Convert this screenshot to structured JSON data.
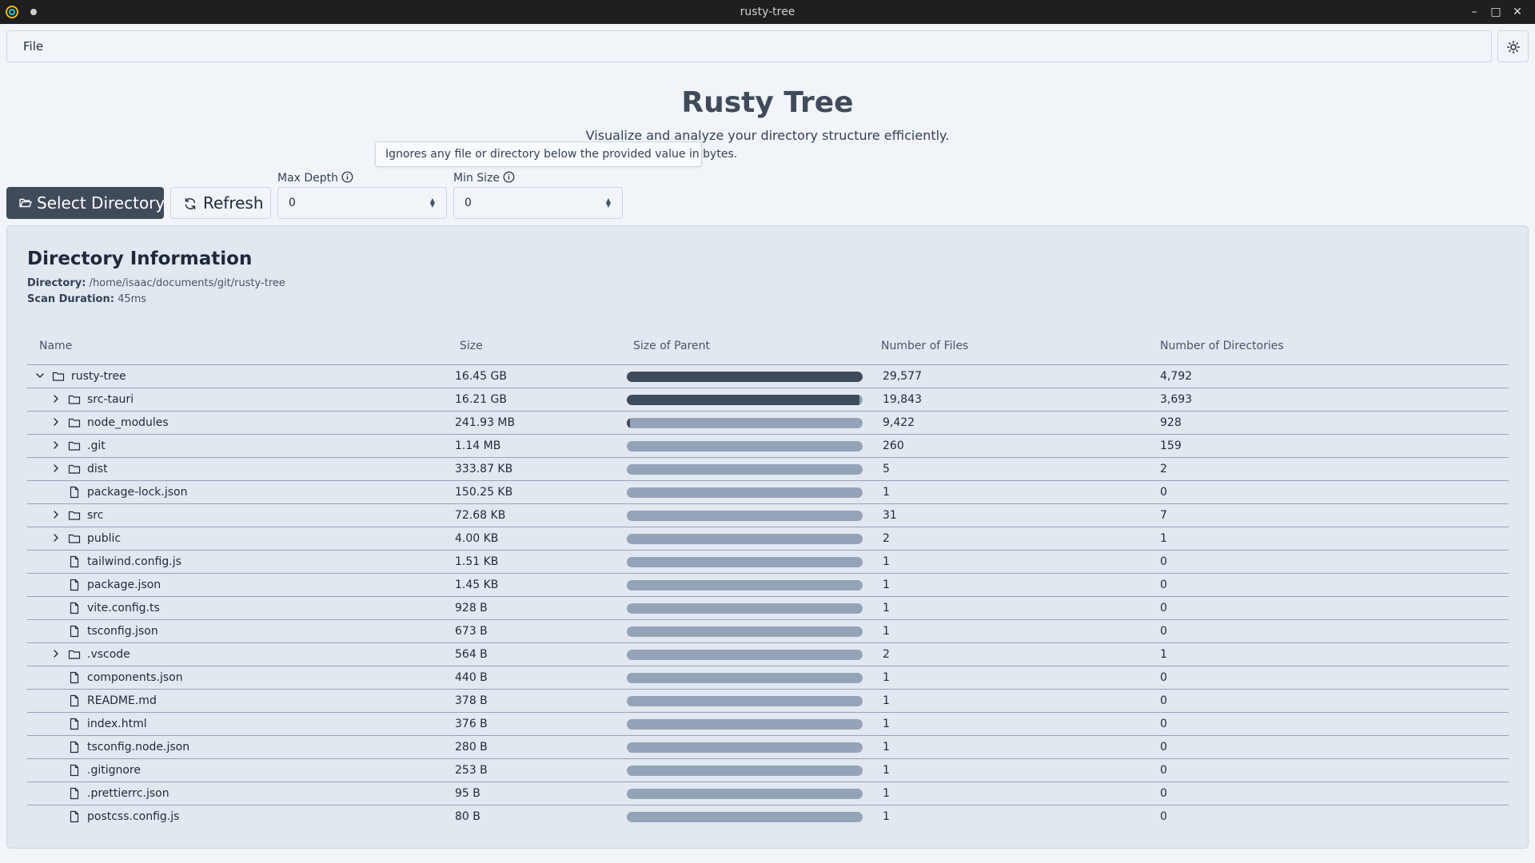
{
  "window": {
    "title": "rusty-tree"
  },
  "menu": {
    "file_label": "File"
  },
  "hero": {
    "title": "Rusty Tree",
    "subtitle": "Visualize and analyze your directory structure efficiently."
  },
  "tooltip": {
    "text": "Ignores any file or directory below the provided value in bytes."
  },
  "controls": {
    "select_directory_label": "Select Directory",
    "refresh_label": "Refresh",
    "max_depth_label": "Max Depth",
    "max_depth_value": "0",
    "min_size_label": "Min Size",
    "min_size_value": "0"
  },
  "panel": {
    "title": "Directory Information",
    "directory_label": "Directory:",
    "directory_value": "/home/isaac/documents/git/rusty-tree",
    "duration_label": "Scan Duration:",
    "duration_value": "45ms"
  },
  "table": {
    "headers": {
      "name": "Name",
      "size": "Size",
      "size_of_parent": "Size of Parent",
      "files": "Number of Files",
      "dirs": "Number of Directories"
    },
    "rows": [
      {
        "name": "rusty-tree",
        "kind": "dir",
        "expanded": true,
        "level": 0,
        "size": "16.45 GB",
        "fraction": 1.0,
        "files": "29,577",
        "dirs": "4,792"
      },
      {
        "name": "src-tauri",
        "kind": "dir",
        "expanded": false,
        "level": 1,
        "size": "16.21 GB",
        "fraction": 0.985,
        "files": "19,843",
        "dirs": "3,693"
      },
      {
        "name": "node_modules",
        "kind": "dir",
        "expanded": false,
        "level": 1,
        "size": "241.93 MB",
        "fraction": 0.015,
        "files": "9,422",
        "dirs": "928"
      },
      {
        "name": ".git",
        "kind": "dir",
        "expanded": false,
        "level": 1,
        "size": "1.14 MB",
        "fraction": 0.0,
        "files": "260",
        "dirs": "159"
      },
      {
        "name": "dist",
        "kind": "dir",
        "expanded": false,
        "level": 1,
        "size": "333.87 KB",
        "fraction": 0.0,
        "files": "5",
        "dirs": "2"
      },
      {
        "name": "package-lock.json",
        "kind": "file",
        "level": 1,
        "size": "150.25 KB",
        "fraction": 0.0,
        "files": "1",
        "dirs": "0"
      },
      {
        "name": "src",
        "kind": "dir",
        "expanded": false,
        "level": 1,
        "size": "72.68 KB",
        "fraction": 0.0,
        "files": "31",
        "dirs": "7"
      },
      {
        "name": "public",
        "kind": "dir",
        "expanded": false,
        "level": 1,
        "size": "4.00 KB",
        "fraction": 0.0,
        "files": "2",
        "dirs": "1"
      },
      {
        "name": "tailwind.config.js",
        "kind": "file",
        "level": 1,
        "size": "1.51 KB",
        "fraction": 0.0,
        "files": "1",
        "dirs": "0"
      },
      {
        "name": "package.json",
        "kind": "file",
        "level": 1,
        "size": "1.45 KB",
        "fraction": 0.0,
        "files": "1",
        "dirs": "0"
      },
      {
        "name": "vite.config.ts",
        "kind": "file",
        "level": 1,
        "size": "928 B",
        "fraction": 0.0,
        "files": "1",
        "dirs": "0"
      },
      {
        "name": "tsconfig.json",
        "kind": "file",
        "level": 1,
        "size": "673 B",
        "fraction": 0.0,
        "files": "1",
        "dirs": "0"
      },
      {
        "name": ".vscode",
        "kind": "dir",
        "expanded": false,
        "level": 1,
        "size": "564 B",
        "fraction": 0.0,
        "files": "2",
        "dirs": "1"
      },
      {
        "name": "components.json",
        "kind": "file",
        "level": 1,
        "size": "440 B",
        "fraction": 0.0,
        "files": "1",
        "dirs": "0"
      },
      {
        "name": "README.md",
        "kind": "file",
        "level": 1,
        "size": "378 B",
        "fraction": 0.0,
        "files": "1",
        "dirs": "0"
      },
      {
        "name": "index.html",
        "kind": "file",
        "level": 1,
        "size": "376 B",
        "fraction": 0.0,
        "files": "1",
        "dirs": "0"
      },
      {
        "name": "tsconfig.node.json",
        "kind": "file",
        "level": 1,
        "size": "280 B",
        "fraction": 0.0,
        "files": "1",
        "dirs": "0"
      },
      {
        "name": ".gitignore",
        "kind": "file",
        "level": 1,
        "size": "253 B",
        "fraction": 0.0,
        "files": "1",
        "dirs": "0"
      },
      {
        "name": ".prettierrc.json",
        "kind": "file",
        "level": 1,
        "size": "95 B",
        "fraction": 0.0,
        "files": "1",
        "dirs": "0"
      },
      {
        "name": "postcss.config.js",
        "kind": "file",
        "level": 1,
        "size": "80 B",
        "fraction": 0.0,
        "files": "1",
        "dirs": "0"
      }
    ]
  },
  "colors": {
    "accent": "#3f4a5a",
    "bar_track": "#94a3b8",
    "panel_bg": "#e2e8f0",
    "page_bg": "#f1f5f9",
    "titlebar_bg": "#1f1f1f"
  },
  "icons": {
    "app": "app-logo-icon",
    "theme": "sun-icon",
    "select": "folder-open-icon",
    "refresh": "refresh-icon",
    "info": "info-icon",
    "dir": "folder-icon",
    "file": "file-icon",
    "expand": "chevron-right-icon",
    "collapse": "chevron-down-icon"
  }
}
